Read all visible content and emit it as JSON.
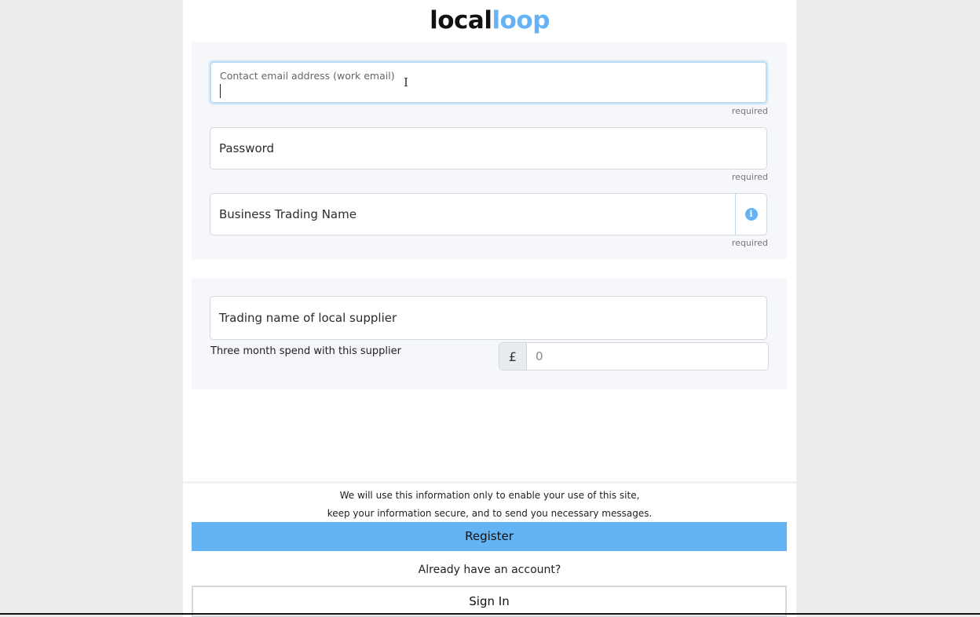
{
  "brand": {
    "part1": "local",
    "part2": "loop"
  },
  "form": {
    "email": {
      "label": "Contact email address (work email)",
      "value": "",
      "required": "required"
    },
    "password": {
      "placeholder": "Password",
      "required": "required"
    },
    "business_name": {
      "placeholder": "Business Trading Name",
      "required": "required",
      "info_icon": "i"
    },
    "supplier_name": {
      "placeholder": "Trading name of local supplier"
    },
    "spend": {
      "label": "Three month spend with this supplier",
      "currency": "£",
      "placeholder": "0"
    }
  },
  "footer": {
    "notice_line1": "We will use this information only to enable your use of this site,",
    "notice_line2": "keep your information secure, and to send you necessary messages.",
    "register_label": "Register",
    "already_text": "Already have an account?",
    "signin_label": "Sign In"
  },
  "colors": {
    "accent": "#63b3f5",
    "section_bg": "#f5f7fb",
    "page_bg": "#ececec"
  }
}
